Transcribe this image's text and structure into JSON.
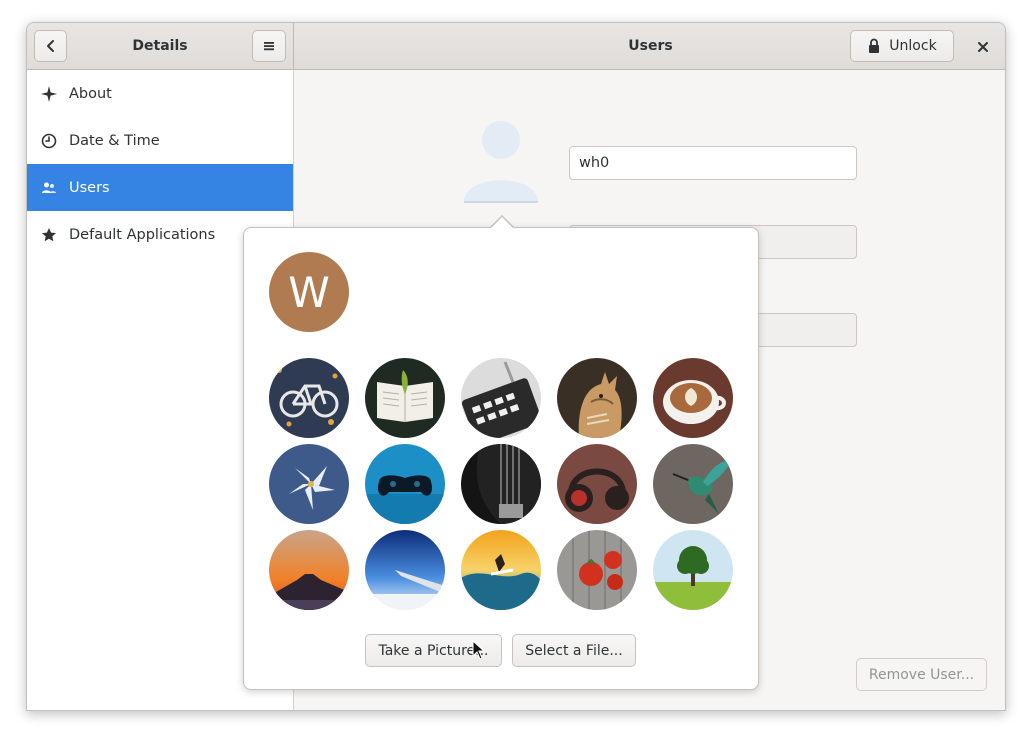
{
  "headerbar": {
    "sidebar_title": "Details",
    "main_title": "Users",
    "unlock_label": "Unlock"
  },
  "sidebar": {
    "items": [
      {
        "label": "About",
        "icon": "sparkle-icon"
      },
      {
        "label": "Date & Time",
        "icon": "clock-icon"
      },
      {
        "label": "Users",
        "icon": "users-icon",
        "selected": true
      },
      {
        "label": "Default Applications",
        "icon": "star-icon"
      }
    ]
  },
  "user": {
    "name_value": "wh0"
  },
  "popover": {
    "avatar_initial": "W",
    "avatar_color": "#b07b50",
    "take_picture_label": "Take a Picture...",
    "select_file_label": "Select a File...",
    "avatars": [
      "bicycle-avatar",
      "book-avatar",
      "calculator-avatar",
      "cat-avatar",
      "coffee-avatar",
      "flower-avatar",
      "gamepad-avatar",
      "guitar-avatar",
      "headphones-avatar",
      "hummingbird-avatar",
      "mountain-avatar",
      "plane-avatar",
      "surfer-avatar",
      "tomatoes-avatar",
      "tree-avatar"
    ]
  },
  "actions": {
    "remove_user_label": "Remove User..."
  },
  "colors": {
    "accent": "#3584e4",
    "window_bg": "#f6f5f4",
    "disabled_text": "#929595"
  }
}
